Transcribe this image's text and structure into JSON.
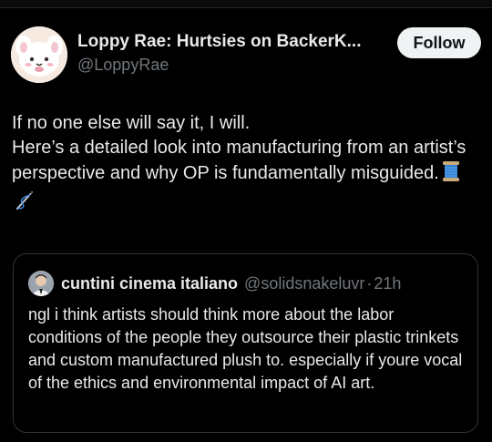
{
  "post": {
    "author": {
      "display_name": "Loppy Rae: Hurtsies on BackerK...",
      "handle": "@LoppyRae",
      "avatar_icon": "plush-bunny-avatar-icon"
    },
    "follow_label": "Follow",
    "text_lines": [
      "If no one else will say it, I will.",
      "Here’s a detailed look into manufacturing from an artist’s perspective and why OP is fundamentally misguided."
    ],
    "emojis": [
      "spool-of-thread-icon",
      "sewing-needle-icon"
    ]
  },
  "quoted_post": {
    "author": {
      "display_name": "cuntini cinema italiano",
      "handle": "@solidsnakeluvr",
      "avatar_icon": "user-photo-avatar-icon"
    },
    "separator": "·",
    "time": "21h",
    "text": "ngl i think artists should think more about the labor conditions of the people they outsource their plastic trinkets and custom manufactured plush to. especially if youre vocal of the ethics and environmental impact of AI art."
  },
  "colors": {
    "background": "#000000",
    "primary_text": "#e7e9ea",
    "secondary_text": "#71767b",
    "border": "#2f3336",
    "follow_button_bg": "#eff3f4",
    "follow_button_text": "#0f1419"
  }
}
